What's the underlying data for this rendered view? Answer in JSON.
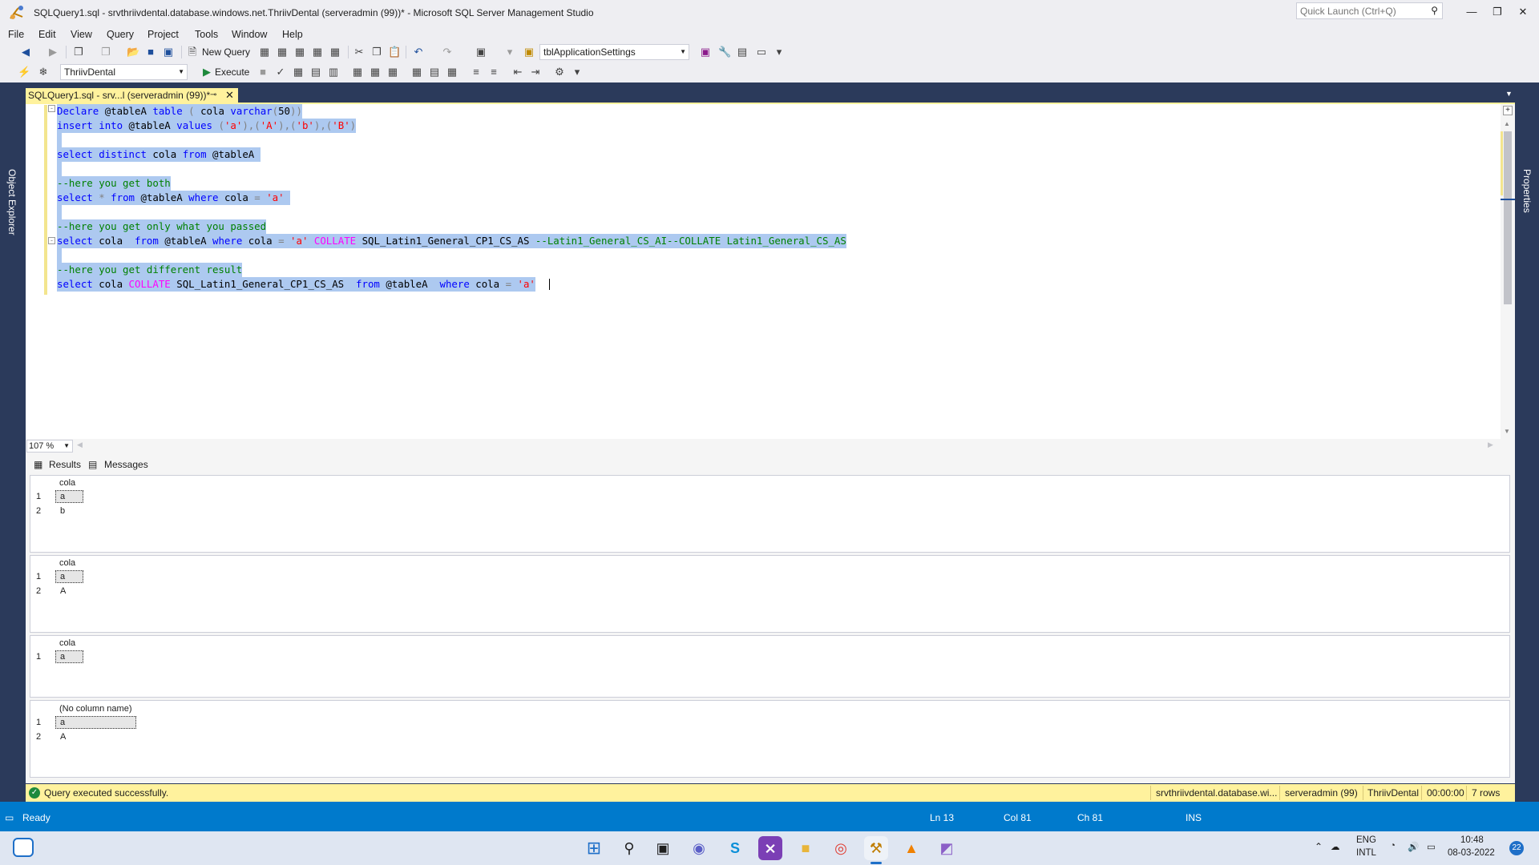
{
  "window": {
    "title": "SQLQuery1.sql - srvthriivdental.database.windows.net.ThriivDental (serveradmin (99))* - Microsoft SQL Server Management Studio",
    "quick_launch_placeholder": "Quick Launch (Ctrl+Q)"
  },
  "menu": [
    "File",
    "Edit",
    "View",
    "Query",
    "Project",
    "Tools",
    "Window",
    "Help"
  ],
  "toolbar": {
    "new_query_label": "New Query",
    "object_combo": "tblApplicationSettings",
    "database_combo": "ThriivDental",
    "execute_label": "Execute"
  },
  "side_panels": {
    "left": "Object Explorer",
    "right": "Properties"
  },
  "document_tab": {
    "label": "SQLQuery1.sql - srv...l (serveradmin (99))*",
    "pin": "⊸",
    "close": "✕"
  },
  "editor": {
    "lines": [
      "Declare @tableA table ( cola varchar(50))",
      "insert into @tableA values ('a'),('A'),('b'),('B')",
      "",
      "select distinct cola from @tableA",
      "",
      "--here you get both",
      "select * from @tableA where cola = 'a'",
      "",
      "--here you get only what you passed",
      "select cola  from @tableA where cola = 'a' COLLATE SQL_Latin1_General_CP1_CS_AS --Latin1_General_CS_AI--COLLATE Latin1_General_CS_AS",
      "",
      "--here you get different result",
      "select cola COLLATE SQL_Latin1_General_CP1_CS_AS  from @tableA  where cola = 'a'"
    ],
    "zoom": "107 %"
  },
  "results_tabs": {
    "results": "Results",
    "messages": "Messages"
  },
  "result_grids": [
    {
      "column": "cola",
      "rows": [
        [
          "1",
          "a"
        ],
        [
          "2",
          "b"
        ]
      ]
    },
    {
      "column": "cola",
      "rows": [
        [
          "1",
          "a"
        ],
        [
          "2",
          "A"
        ]
      ]
    },
    {
      "column": "cola",
      "rows": [
        [
          "1",
          "a"
        ]
      ]
    },
    {
      "column": "(No column name)",
      "rows": [
        [
          "1",
          "a"
        ],
        [
          "2",
          "A"
        ]
      ]
    }
  ],
  "query_status": {
    "message": "Query executed successfully.",
    "server": "srvthriivdental.database.wi...",
    "user": "serveradmin (99)",
    "database": "ThriivDental",
    "elapsed": "00:00:00",
    "rows": "7 rows"
  },
  "statusbar": {
    "state": "Ready",
    "line": "Ln 13",
    "col": "Col 81",
    "ch": "Ch 81",
    "mode": "INS"
  },
  "tray": {
    "lang1": "ENG",
    "lang2": "INTL",
    "time": "10:48",
    "date": "08-03-2022",
    "badge": "22"
  },
  "colors": {
    "accent": "#007acc",
    "tab_yellow": "#fff29d",
    "chrome": "#2b3a5b",
    "selection": "#adc9f0"
  }
}
